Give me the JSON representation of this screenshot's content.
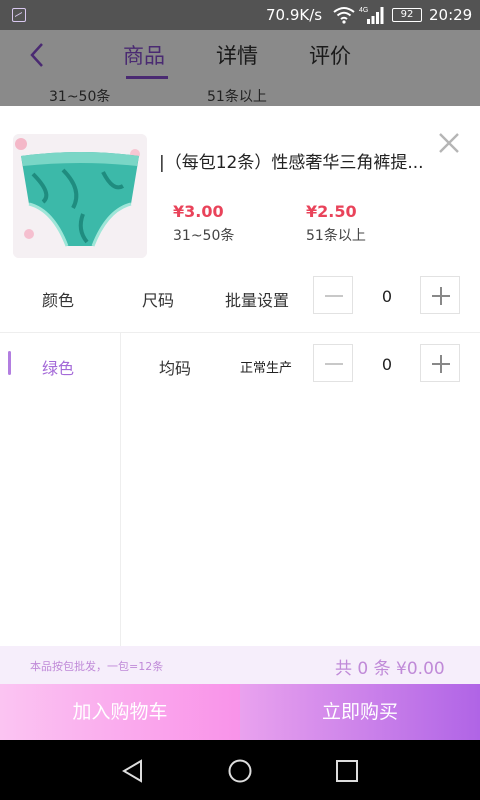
{
  "status_bar": {
    "speed": "70.9K/s",
    "network": "4G",
    "battery": "92",
    "time": "20:29"
  },
  "header": {
    "tabs": [
      {
        "label": "商品",
        "active": true
      },
      {
        "label": "详情",
        "active": false
      },
      {
        "label": "评价",
        "active": false
      }
    ],
    "tiers": [
      "31~50条",
      "51条以上"
    ]
  },
  "product": {
    "title": "|（每包12条）性感奢华三角裤提...",
    "prices": [
      {
        "price": "¥3.00",
        "range": "31~50条"
      },
      {
        "price": "¥2.50",
        "range": "51条以上"
      }
    ]
  },
  "selector": {
    "color_label": "颜色",
    "size_label": "尺码",
    "batch_label": "批量设置",
    "batch_qty": "0",
    "colors": [
      "绿色"
    ],
    "rows": [
      {
        "size": "均码",
        "status": "正常生产",
        "qty": "0"
      }
    ]
  },
  "footer": {
    "note": "本品按包批发，一包=12条",
    "total": "共 0 条   ¥0.00"
  },
  "actions": {
    "add_to_cart": "加入购物车",
    "buy_now": "立即购买"
  },
  "colors": {
    "accent": "#a46ad8",
    "price": "#e9435a",
    "tab_active": "#4a2a72"
  }
}
